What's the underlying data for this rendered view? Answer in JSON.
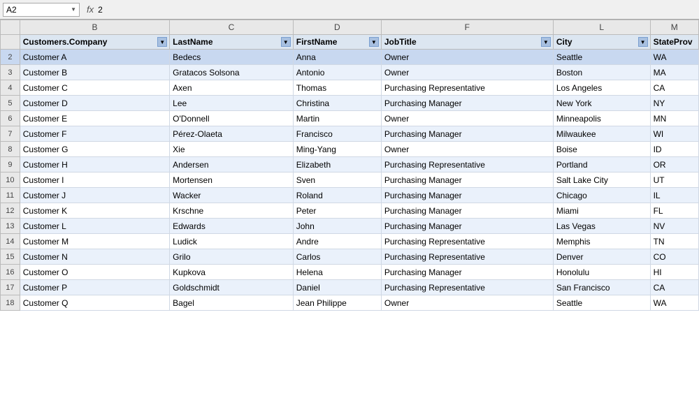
{
  "formulaBar": {
    "cellRef": "A2",
    "fxLabel": "fx",
    "formulaValue": "2"
  },
  "columns": {
    "letters": [
      "",
      "B",
      "C",
      "D",
      "F",
      "L",
      "M"
    ],
    "headers": [
      "Customers.Company",
      "LastName",
      "FirstName",
      "JobTitle",
      "City",
      "StateProv"
    ]
  },
  "rows": [
    {
      "num": "2",
      "company": "Customer A",
      "lastName": "Bedecs",
      "firstName": "Anna",
      "jobTitle": "Owner",
      "city": "Seattle",
      "state": "WA"
    },
    {
      "num": "3",
      "company": "Customer B",
      "lastName": "Gratacos Solsona",
      "firstName": "Antonio",
      "jobTitle": "Owner",
      "city": "Boston",
      "state": "MA"
    },
    {
      "num": "4",
      "company": "Customer C",
      "lastName": "Axen",
      "firstName": "Thomas",
      "jobTitle": "Purchasing Representative",
      "city": "Los Angeles",
      "state": "CA"
    },
    {
      "num": "5",
      "company": "Customer D",
      "lastName": "Lee",
      "firstName": "Christina",
      "jobTitle": "Purchasing Manager",
      "city": "New York",
      "state": "NY"
    },
    {
      "num": "6",
      "company": "Customer E",
      "lastName": "O'Donnell",
      "firstName": "Martin",
      "jobTitle": "Owner",
      "city": "Minneapolis",
      "state": "MN"
    },
    {
      "num": "7",
      "company": "Customer F",
      "lastName": "Pérez-Olaeta",
      "firstName": "Francisco",
      "jobTitle": "Purchasing Manager",
      "city": "Milwaukee",
      "state": "WI"
    },
    {
      "num": "8",
      "company": "Customer G",
      "lastName": "Xie",
      "firstName": "Ming-Yang",
      "jobTitle": "Owner",
      "city": "Boise",
      "state": "ID"
    },
    {
      "num": "9",
      "company": "Customer H",
      "lastName": "Andersen",
      "firstName": "Elizabeth",
      "jobTitle": "Purchasing Representative",
      "city": "Portland",
      "state": "OR"
    },
    {
      "num": "10",
      "company": "Customer I",
      "lastName": "Mortensen",
      "firstName": "Sven",
      "jobTitle": "Purchasing Manager",
      "city": "Salt Lake City",
      "state": "UT"
    },
    {
      "num": "11",
      "company": "Customer J",
      "lastName": "Wacker",
      "firstName": "Roland",
      "jobTitle": "Purchasing Manager",
      "city": "Chicago",
      "state": "IL"
    },
    {
      "num": "12",
      "company": "Customer K",
      "lastName": "Krschne",
      "firstName": "Peter",
      "jobTitle": "Purchasing Manager",
      "city": "Miami",
      "state": "FL"
    },
    {
      "num": "13",
      "company": "Customer L",
      "lastName": "Edwards",
      "firstName": "John",
      "jobTitle": "Purchasing Manager",
      "city": "Las Vegas",
      "state": "NV"
    },
    {
      "num": "14",
      "company": "Customer M",
      "lastName": "Ludick",
      "firstName": "Andre",
      "jobTitle": "Purchasing Representative",
      "city": "Memphis",
      "state": "TN"
    },
    {
      "num": "15",
      "company": "Customer N",
      "lastName": "Grilo",
      "firstName": "Carlos",
      "jobTitle": "Purchasing Representative",
      "city": "Denver",
      "state": "CO"
    },
    {
      "num": "16",
      "company": "Customer O",
      "lastName": "Kupkova",
      "firstName": "Helena",
      "jobTitle": "Purchasing Manager",
      "city": "Honolulu",
      "state": "HI"
    },
    {
      "num": "17",
      "company": "Customer P",
      "lastName": "Goldschmidt",
      "firstName": "Daniel",
      "jobTitle": "Purchasing Representative",
      "city": "San Francisco",
      "state": "CA"
    },
    {
      "num": "18",
      "company": "Customer Q",
      "lastName": "Bagel",
      "firstName": "Jean Philippe",
      "jobTitle": "Owner",
      "city": "Seattle",
      "state": "WA"
    }
  ]
}
